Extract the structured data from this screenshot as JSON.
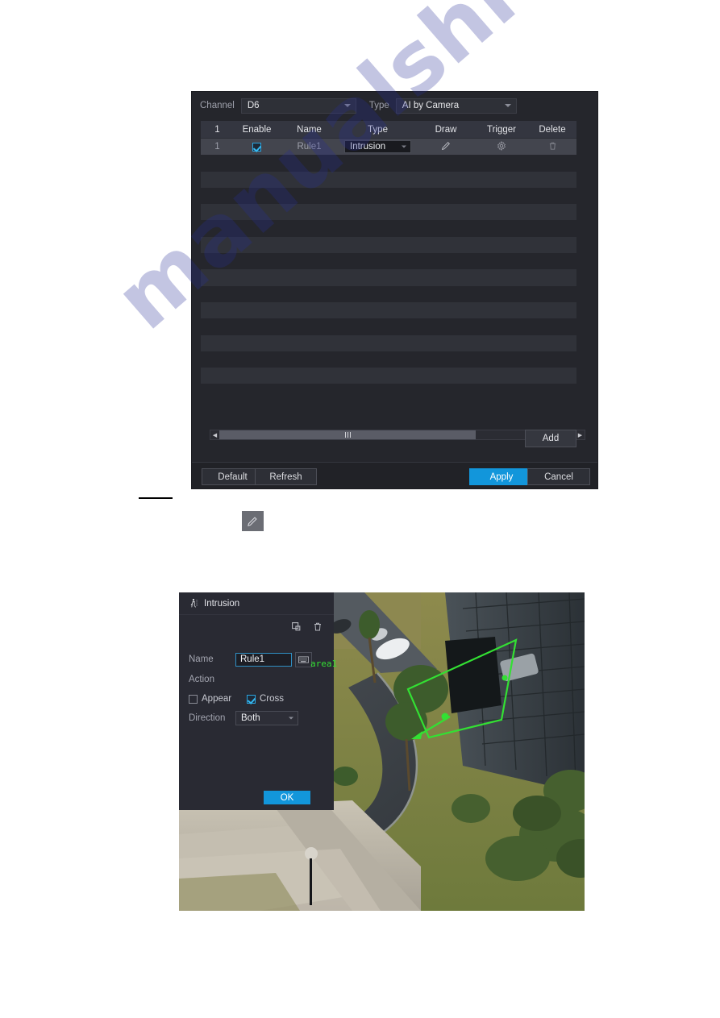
{
  "rules_dialog": {
    "channel_label": "Channel",
    "channel_value": "D6",
    "type_label": "Type",
    "type_value": "AI by Camera",
    "table": {
      "headers": [
        "1",
        "Enable",
        "Name",
        "Type",
        "Draw",
        "Trigger",
        "Delete"
      ],
      "rows": [
        {
          "index": "1",
          "enabled": true,
          "name": "Rule1",
          "type": "Intrusion",
          "draw_icon": "pencil-icon",
          "trigger_icon": "gear-icon",
          "delete_icon": "trash-icon"
        }
      ],
      "empty_row_count": 15
    },
    "add_label": "Add",
    "default_label": "Default",
    "refresh_label": "Refresh",
    "apply_label": "Apply",
    "cancel_label": "Cancel",
    "accent_color": "#1296db"
  },
  "standalone_icon": {
    "name": "pencil-icon"
  },
  "intrusion_dialog": {
    "title": "Intrusion",
    "title_icon": "intrusion-person-icon",
    "copy_icon": "copy-area-icon",
    "delete_icon": "trash-icon",
    "name_label": "Name",
    "name_value": "Rule1",
    "keyboard_icon": "keyboard-icon",
    "action_label": "Action",
    "appear_label": "Appear",
    "appear_checked": false,
    "cross_label": "Cross",
    "cross_checked": true,
    "direction_label": "Direction",
    "direction_value": "Both",
    "ok_label": "OK",
    "overlay": {
      "area_label": "area1",
      "area_color": "#33e033"
    }
  },
  "page": {
    "watermark": "manualshive.com"
  }
}
